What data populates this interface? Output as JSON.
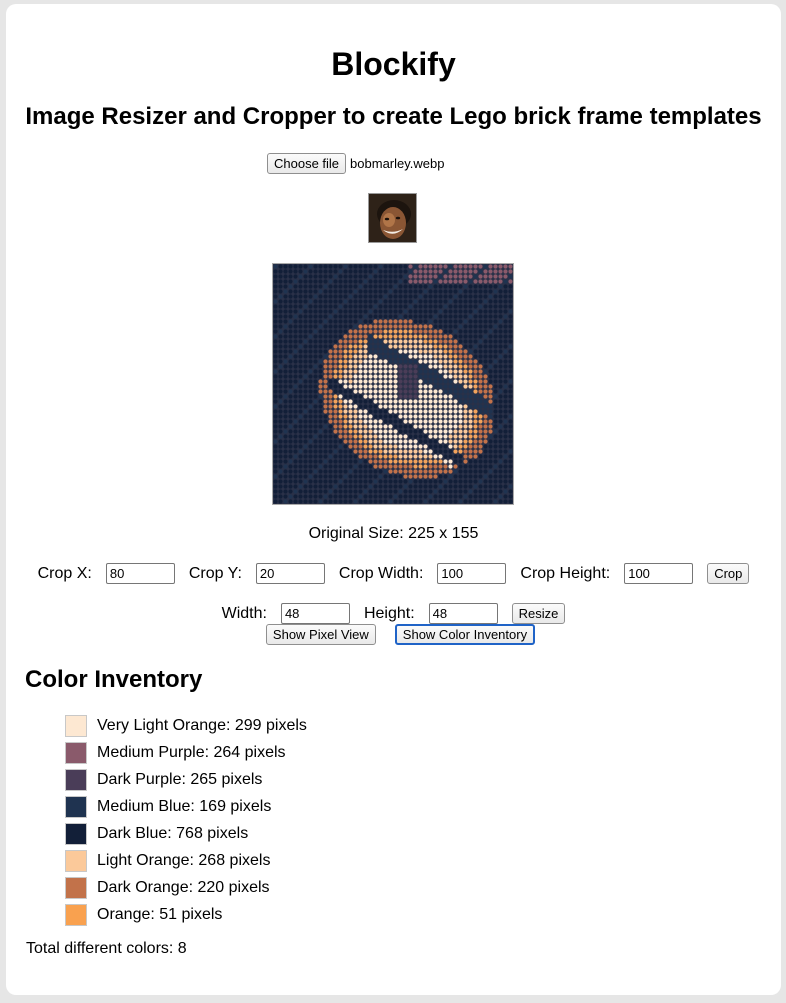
{
  "app": {
    "title": "Blockify",
    "subtitle": "Image Resizer and Cropper to create Lego brick frame templates"
  },
  "file": {
    "button_label": "Choose file",
    "filename": "bobmarley.webp"
  },
  "preview": {
    "original_size_label": "Original Size: 225 x 155",
    "mosaic_palette": [
      "#fde8d2",
      "#fbc99a",
      "#f2a35c",
      "#c2724a",
      "#8a5a6b",
      "#4a3d58",
      "#1f3350",
      "#121f38"
    ]
  },
  "crop": {
    "x_label": "Crop X:",
    "x_value": "80",
    "y_label": "Crop Y:",
    "y_value": "20",
    "width_label": "Crop Width:",
    "width_value": "100",
    "height_label": "Crop Height:",
    "height_value": "100",
    "button_label": "Crop"
  },
  "resize": {
    "width_label": "Width:",
    "width_value": "48",
    "height_label": "Height:",
    "height_value": "48",
    "button_label": "Resize"
  },
  "view": {
    "pixel_view_label": "Show Pixel View",
    "color_inventory_label": "Show Color Inventory"
  },
  "inventory": {
    "title": "Color Inventory",
    "items": [
      {
        "color": "#fde8d2",
        "text": "Very Light Orange: 299 pixels"
      },
      {
        "color": "#8a5a6b",
        "text": "Medium Purple: 264 pixels"
      },
      {
        "color": "#4a3d58",
        "text": "Dark Purple: 265 pixels"
      },
      {
        "color": "#1f3350",
        "text": "Medium Blue: 169 pixels"
      },
      {
        "color": "#121f38",
        "text": "Dark Blue: 768 pixels"
      },
      {
        "color": "#fbc99a",
        "text": "Light Orange: 268 pixels"
      },
      {
        "color": "#c2724a",
        "text": "Dark Orange: 220 pixels"
      },
      {
        "color": "#f9a14f",
        "text": "Orange: 51 pixels"
      }
    ],
    "total_label": "Total different colors: 8"
  }
}
